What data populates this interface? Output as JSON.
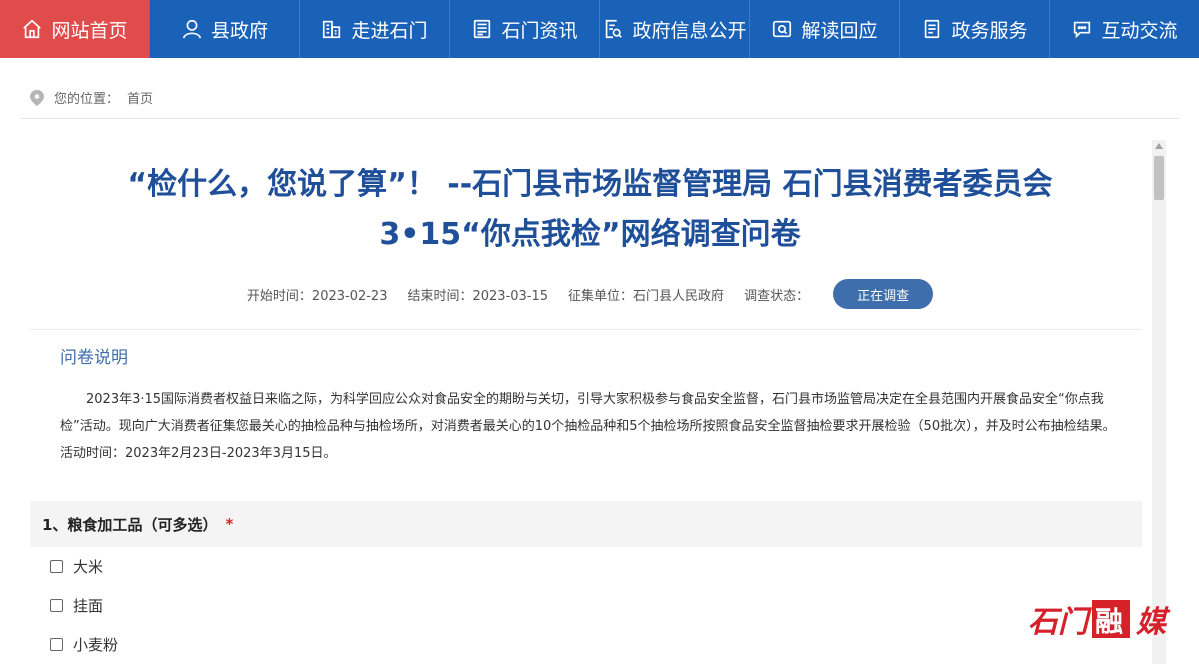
{
  "nav": [
    {
      "label": "网站首页",
      "icon": "home-icon",
      "active": true
    },
    {
      "label": "县政府",
      "icon": "user-icon"
    },
    {
      "label": "走进石门",
      "icon": "building-icon"
    },
    {
      "label": "石门资讯",
      "icon": "news-icon"
    },
    {
      "label": "政府信息公开",
      "icon": "doc-search-icon"
    },
    {
      "label": "解读回应",
      "icon": "read-icon"
    },
    {
      "label": "政务服务",
      "icon": "service-icon"
    },
    {
      "label": "互动交流",
      "icon": "chat-icon"
    }
  ],
  "breadcrumb": {
    "prefix": "您的位置：",
    "home": "首页"
  },
  "survey": {
    "title_line1": "“检什么，您说了算”！ --石门县市场监督管理局 石门县消费者委员会",
    "title_line2": "3•15“你点我检”网络调查问卷",
    "start": "开始时间：2023-02-23",
    "end": "结束时间：2023-03-15",
    "unit": "征集单位：石门县人民政府",
    "status_label": "调查状态：",
    "status_value": "正在调查",
    "intro_heading": "问卷说明",
    "intro_text": "2023年3·15国际消费者权益日来临之际，为科学回应公众对食品安全的期盼与关切，引导大家积极参与食品安全监督，石门县市场监管局决定在全县范围内开展食品安全“你点我检”活动。现向广大消费者征集您最关心的抽检品种与抽检场所，对消费者最关心的10个抽检品种和5个抽检场所按照食品安全监督抽检要求开展检验（50批次），并及时公布抽检结果。活动时间：2023年2月23日-2023年3月15日。",
    "question1": {
      "title": "1、粮食加工品（可多选）",
      "required_mark": "*",
      "options": [
        "大米",
        "挂面",
        "小麦粉"
      ]
    }
  },
  "logo_text": "石门融媒",
  "colors": {
    "nav_bg": "#1a62b8",
    "nav_active": "#e04b4b",
    "title": "#1f4f99",
    "status_btn": "#3e6eab",
    "logo_red": "#d6202a"
  }
}
